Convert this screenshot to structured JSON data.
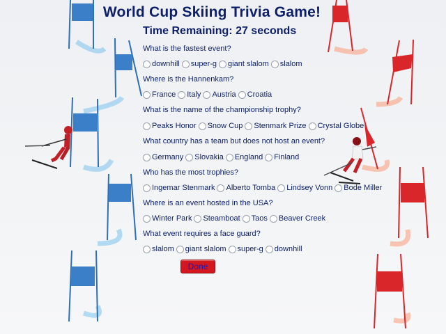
{
  "title": "World Cup Skiing Trivia Game!",
  "timer": "Time Remaining: 27 seconds",
  "questions": [
    {
      "text": "What is the fastest event?",
      "options": [
        "downhill",
        "super-g",
        "giant slalom",
        "slalom"
      ]
    },
    {
      "text": "Where is the Hannenkam?",
      "options": [
        "France",
        "Italy",
        "Austria",
        "Croatia"
      ]
    },
    {
      "text": "What is the name of the championship trophy?",
      "options": [
        "Peaks Honor",
        "Snow Cup",
        "Stenmark Prize",
        "Crystal Globe"
      ]
    },
    {
      "text": "What country has a team but does not host an event?",
      "options": [
        "Germany",
        "Slovakia",
        "England",
        "Finland"
      ]
    },
    {
      "text": "Who has the most trophies?",
      "options": [
        "Ingemar Stenmark",
        "Alberto Tomba",
        "Lindsey Vonn",
        "Bode Miller"
      ]
    },
    {
      "text": "Where is an event hosted in the USA?",
      "options": [
        "Winter Park",
        "Steamboat",
        "Taos",
        "Beaver Creek"
      ]
    },
    {
      "text": "What event requires a face guard?",
      "options": [
        "slalom",
        "giant slalom",
        "super-g",
        "downhill"
      ]
    }
  ],
  "done_label": "Done",
  "colors": {
    "text": "#0d1f68",
    "done_bg": "#d4161f",
    "done_text": "#1b1bb5",
    "blue_gate": "#2e6fb5",
    "red_gate": "#d8262a"
  }
}
